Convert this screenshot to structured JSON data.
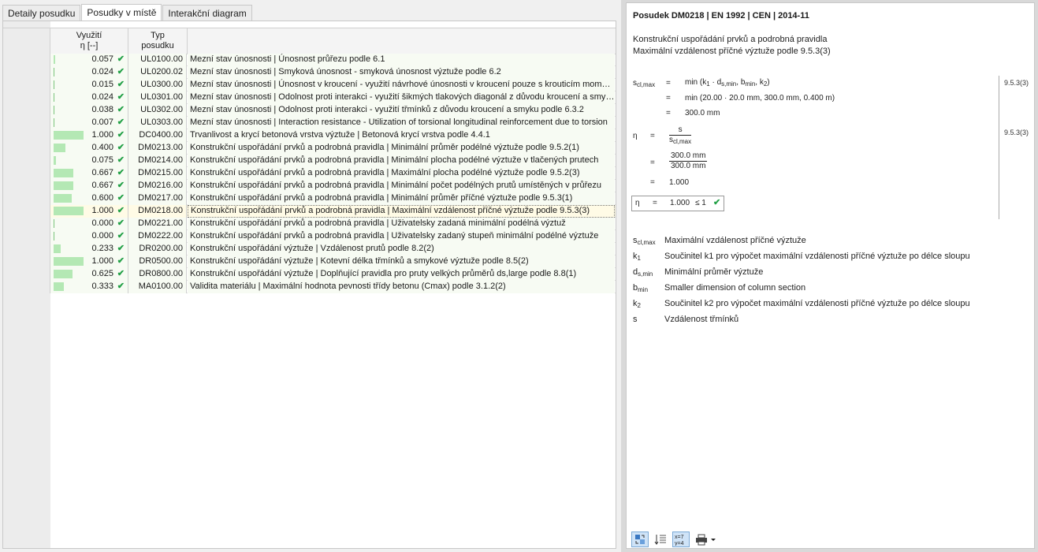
{
  "tabs": [
    "Detaily posudku",
    "Posudky v místě",
    "Interakční diagram"
  ],
  "active_tab": 1,
  "table": {
    "col_util_1": "Využití",
    "col_util_2": "η [--]",
    "col_type_1": "Typ",
    "col_type_2": "posudku",
    "rows": [
      {
        "util": "0.057",
        "ratio": 0.057,
        "type": "UL0100.00",
        "desc": "Mezní stav únosnosti | Únosnost průřezu podle 6.1"
      },
      {
        "util": "0.024",
        "ratio": 0.024,
        "type": "UL0200.02",
        "desc": "Mezní stav únosnosti | Smyková únosnost - smyková únosnost výztuže podle 6.2"
      },
      {
        "util": "0.015",
        "ratio": 0.015,
        "type": "UL0300.00",
        "desc": "Mezní stav únosnosti | Únosnost v kroucení - využití návrhové únosnosti v kroucení pouze s krouticím momentem"
      },
      {
        "util": "0.024",
        "ratio": 0.024,
        "type": "UL0301.00",
        "desc": "Mezní stav únosnosti | Odolnost proti interakci - využití šikmých tlakových diagonál z důvodu kroucení a smyku"
      },
      {
        "util": "0.038",
        "ratio": 0.038,
        "type": "UL0302.00",
        "desc": "Mezní stav únosnosti | Odolnost proti interakci - využití třmínků z důvodu kroucení a smyku podle 6.3.2"
      },
      {
        "util": "0.007",
        "ratio": 0.007,
        "type": "UL0303.00",
        "desc": "Mezní stav únosnosti | Interaction resistance - Utilization of torsional longitudinal reinforcement due to torsion"
      },
      {
        "util": "1.000",
        "ratio": 1.0,
        "type": "DC0400.00",
        "desc": "Trvanlivost a krycí betonová vrstva výztuže | Betonová krycí vrstva podle 4.4.1"
      },
      {
        "util": "0.400",
        "ratio": 0.4,
        "type": "DM0213.00",
        "desc": "Konstrukční uspořádání prvků a podrobná pravidla | Minimální průměr podélné výztuže podle 9.5.2(1)"
      },
      {
        "util": "0.075",
        "ratio": 0.075,
        "type": "DM0214.00",
        "desc": "Konstrukční uspořádání prvků a podrobná pravidla | Minimální plocha podélné výztuže v tlačených prutech"
      },
      {
        "util": "0.667",
        "ratio": 0.667,
        "type": "DM0215.00",
        "desc": "Konstrukční uspořádání prvků a podrobná pravidla | Maximální plocha podélné výztuže podle 9.5.2(3)"
      },
      {
        "util": "0.667",
        "ratio": 0.667,
        "type": "DM0216.00",
        "desc": "Konstrukční uspořádání prvků a podrobná pravidla | Minimální počet podélných prutů umístěných v průřezu"
      },
      {
        "util": "0.600",
        "ratio": 0.6,
        "type": "DM0217.00",
        "desc": "Konstrukční uspořádání prvků a podrobná pravidla | Minimální průměr příčné výztuže podle 9.5.3(1)"
      },
      {
        "util": "1.000",
        "ratio": 1.0,
        "type": "DM0218.00",
        "desc": "Konstrukční uspořádání prvků a podrobná pravidla | Maximální vzdálenost příčné výztuže podle 9.5.3(3)",
        "selected": true
      },
      {
        "util": "0.000",
        "ratio": 0.0,
        "type": "DM0221.00",
        "desc": "Konstrukční uspořádání prvků a podrobná pravidla | Uživatelsky zadaná minimální podélná výztuž"
      },
      {
        "util": "0.000",
        "ratio": 0.0,
        "type": "DM0222.00",
        "desc": "Konstrukční uspořádání prvků a podrobná pravidla | Uživatelsky zadaný stupeň minimální podélné výztuže"
      },
      {
        "util": "0.233",
        "ratio": 0.233,
        "type": "DR0200.00",
        "desc": "Konstrukční uspořádání výztuže | Vzdálenost prutů podle 8.2(2)"
      },
      {
        "util": "1.000",
        "ratio": 1.0,
        "type": "DR0500.00",
        "desc": "Konstrukční uspořádání výztuže | Kotevní délka třmínků a smykové výztuže podle 8.5(2)"
      },
      {
        "util": "0.625",
        "ratio": 0.625,
        "type": "DR0800.00",
        "desc": "Konstrukční uspořádání výztuže | Doplňující pravidla pro pruty velkých průměrů ds,large podle 8.8(1)"
      },
      {
        "util": "0.333",
        "ratio": 0.333,
        "type": "MA0100.00",
        "desc": "Validita materiálu | Maximální hodnota pevnosti třídy betonu (Cmax) podle 3.1.2(2)"
      }
    ]
  },
  "detail": {
    "title": "Posudek DM0218 | EN 1992 | CEN | 2014-11",
    "subtitle1": "Konstrukční uspořádání prvků a podrobná pravidla",
    "subtitle2": "Maximální vzdálenost příčné výztuže podle 9.5.3(3)",
    "eq1_lhs": "s",
    "eq1_lhs_sub": "cl,max",
    "eq1_l1": "min (k",
    "eq1_l2": "min (20.00  ·  20.0 mm,  300.0 mm,  0.400 m)",
    "eq1_l3": "300.0 mm",
    "eq2_lhs": "η",
    "eq2_num": "s",
    "eq2_den": "s",
    "eq2_den_sub": "cl,max",
    "eq2_num2": "300.0 mm",
    "eq2_den2": "300.0 mm",
    "eq2_l3": "1.000",
    "result_lhs": "η",
    "result_val": "1.000",
    "result_cmp": "≤ 1",
    "ref1": "9.5.3(3)",
    "ref2": "9.5.3(3)",
    "legend": [
      {
        "sym": "s",
        "sub": "cl,max",
        "text": "Maximální vzdálenost příčné výztuže"
      },
      {
        "sym": "k",
        "sub": "1",
        "text": "Součinitel k1 pro výpočet maximální vzdálenosti příčné výztuže po délce sloupu"
      },
      {
        "sym": "d",
        "sub": "s,min",
        "text": "Minimální průměr výztuže"
      },
      {
        "sym": "b",
        "sub": "min",
        "text": "Smaller dimension of column section"
      },
      {
        "sym": "k",
        "sub": "2",
        "text": "Součinitel k2 pro výpočet maximální vzdálenosti příčné výztuže po délce sloupu"
      },
      {
        "sym": "s",
        "sub": "",
        "text": "Vzdálenost třmínků"
      }
    ]
  },
  "toolbar": [
    "swap-icon",
    "list-sort-icon",
    "formula-icon",
    "print-icon"
  ]
}
